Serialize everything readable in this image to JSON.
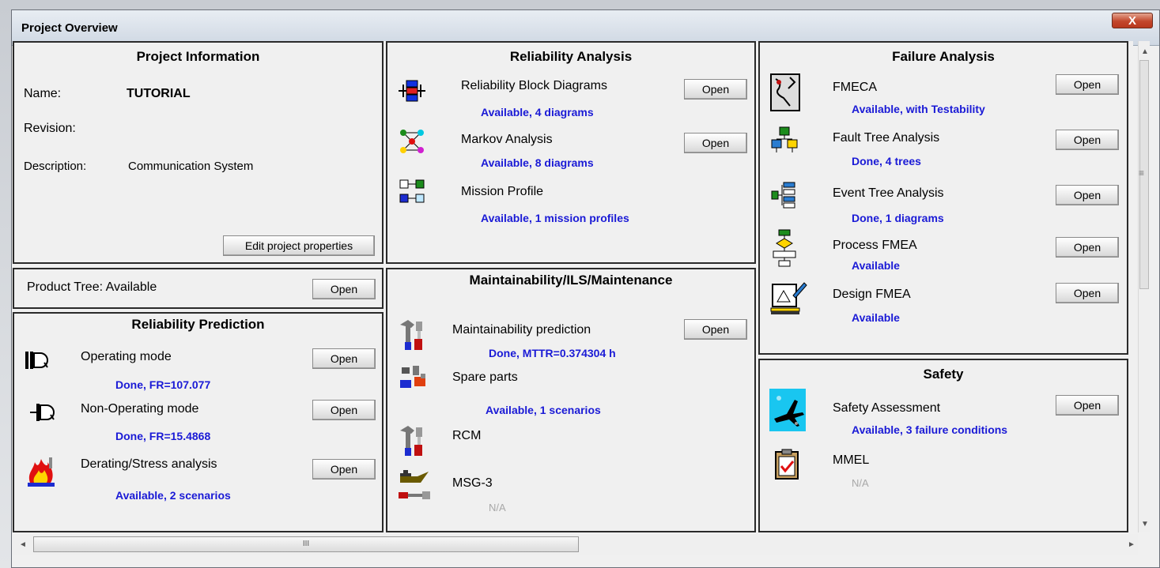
{
  "window": {
    "title": "Project Overview",
    "close_glyph": "X"
  },
  "project_info": {
    "title": "Project Information",
    "name_label": "Name:",
    "name_value": "TUTORIAL",
    "revision_label": "Revision:",
    "description_label": "Description:",
    "description_value": "Communication System",
    "edit_button": "Edit project properties"
  },
  "product_tree": {
    "label": "Product Tree: Available",
    "open": "Open"
  },
  "reliability_prediction": {
    "title": "Reliability Prediction",
    "items": [
      {
        "label": "Operating mode",
        "status": "Done, FR=107.077",
        "open": "Open",
        "icon": "operating-mode-icon"
      },
      {
        "label": "Non-Operating mode",
        "status": "Done, FR=15.4868",
        "open": "Open",
        "icon": "non-operating-mode-icon"
      },
      {
        "label": "Derating/Stress analysis",
        "status": "Available, 2 scenarios",
        "open": "Open",
        "icon": "derating-flame-icon"
      }
    ]
  },
  "reliability_analysis": {
    "title": "Reliability Analysis",
    "items": [
      {
        "label": "Reliability Block Diagrams",
        "status": "Available, 4 diagrams",
        "open": "Open",
        "icon": "block-diagram-icon"
      },
      {
        "label": "Markov Analysis",
        "status": "Available, 8 diagrams",
        "open": "Open",
        "icon": "markov-icon"
      },
      {
        "label": "Mission Profile",
        "status": "Available, 1 mission profiles",
        "icon": "mission-profile-icon"
      }
    ]
  },
  "maintainability": {
    "title": "Maintainability/ILS/Maintenance",
    "items": [
      {
        "label": "Maintainability prediction",
        "status": "Done, MTTR=0.374304 h",
        "open": "Open",
        "icon": "tools-icon"
      },
      {
        "label": "Spare parts",
        "status": "Available, 1 scenarios",
        "icon": "spare-parts-icon"
      },
      {
        "label": "RCM",
        "icon": "rcm-tools-icon"
      },
      {
        "label": "MSG-3",
        "status": "N/A",
        "icon": "oil-can-icon"
      }
    ]
  },
  "failure_analysis": {
    "title": "Failure Analysis",
    "items": [
      {
        "label": "FMECA",
        "status": "Available, with Testability",
        "open": "Open",
        "icon": "fmeca-icon"
      },
      {
        "label": "Fault Tree Analysis",
        "status": "Done, 4 trees",
        "open": "Open",
        "icon": "fault-tree-icon"
      },
      {
        "label": "Event Tree Analysis",
        "status": "Done, 1 diagrams",
        "open": "Open",
        "icon": "event-tree-icon"
      },
      {
        "label": "Process FMEA",
        "status": "Available",
        "open": "Open",
        "icon": "process-fmea-icon"
      },
      {
        "label": "Design FMEA",
        "status": "Available",
        "open": "Open",
        "icon": "design-fmea-icon"
      }
    ]
  },
  "safety": {
    "title": "Safety",
    "items": [
      {
        "label": "Safety Assessment",
        "status": "Available, 3 failure conditions",
        "open": "Open",
        "icon": "airplane-icon"
      },
      {
        "label": "MMEL",
        "status": "N/A",
        "icon": "clipboard-check-icon"
      }
    ]
  },
  "scrollbar": {
    "grip": "III",
    "side_grip": "≡"
  }
}
